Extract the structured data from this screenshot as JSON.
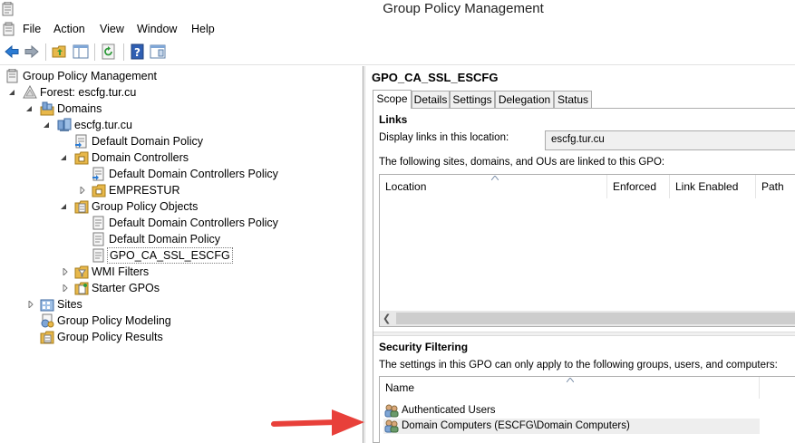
{
  "window": {
    "title": "Group Policy Management"
  },
  "menubar": {
    "items": [
      "File",
      "Action",
      "View",
      "Window",
      "Help"
    ]
  },
  "toolbar": {
    "buttons": [
      "back-icon",
      "forward-icon",
      "folder-up-icon",
      "show-hide-tree-icon",
      "refresh-icon",
      "help-icon",
      "properties-icon"
    ]
  },
  "tree": {
    "root": "Group Policy Management",
    "forest": "Forest: escfg.tur.cu",
    "domains": "Domains",
    "domain": "escfg.tur.cu",
    "default_domain_policy": "Default Domain Policy",
    "domain_controllers": "Domain Controllers",
    "ddc_policy": "Default Domain Controllers Policy",
    "emprestur": "EMPRESTUR",
    "gpo_folder": "Group Policy Objects",
    "gpo_ddc_policy": "Default Domain Controllers Policy",
    "gpo_default_domain_policy": "Default Domain Policy",
    "gpo_ssl": "GPO_CA_SSL_ESCFG",
    "wmi_filters": "WMI Filters",
    "starter_gpos": "Starter GPOs",
    "sites": "Sites",
    "modeling": "Group Policy Modeling",
    "results": "Group Policy Results"
  },
  "details": {
    "gpo_name": "GPO_CA_SSL_ESCFG",
    "tabs": [
      "Scope",
      "Details",
      "Settings",
      "Delegation",
      "Status"
    ],
    "active_tab": "Scope",
    "links": {
      "heading": "Links",
      "location_label": "Display links in this location:",
      "location_value": "escfg.tur.cu",
      "description": "The following sites, domains, and OUs are linked to this GPO:",
      "columns": [
        "Location",
        "Enforced",
        "Link Enabled",
        "Path"
      ]
    },
    "security_filtering": {
      "heading": "Security Filtering",
      "description": "The settings in this GPO can only apply to the following groups, users, and computers:",
      "column": "Name",
      "rows": [
        "Authenticated Users",
        "Domain Computers (ESCFG\\Domain Computers)"
      ]
    }
  },
  "colors": {
    "annotation_arrow": "#e8403a",
    "folder": "#e8b84a"
  }
}
